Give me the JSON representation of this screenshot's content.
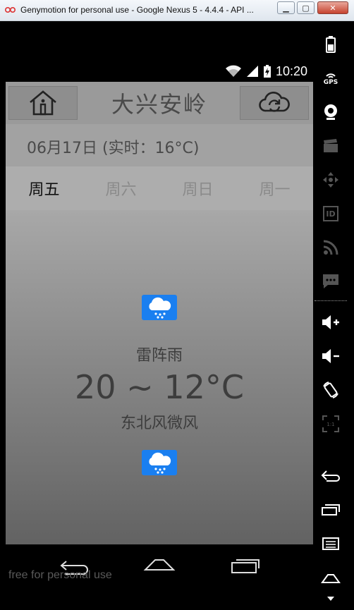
{
  "window": {
    "title": "Genymotion for personal use - Google Nexus 5 - 4.4.4 - API ..."
  },
  "status_bar": {
    "time": "10:20"
  },
  "app": {
    "city": "大兴安岭",
    "date_line": "06月17日 (实时：16°C)",
    "tabs": [
      {
        "label": "周五",
        "active": true
      },
      {
        "label": "周六",
        "active": false
      },
      {
        "label": "周日",
        "active": false
      },
      {
        "label": "周一",
        "active": false
      }
    ],
    "weather": {
      "condition": "雷阵雨",
      "temperature": "20 ~ 12°C",
      "wind": "东北风微风",
      "icon": "rain-cloud-icon",
      "icon_color": "#1a7ff0"
    }
  },
  "watermark": "free for personal use",
  "toolbar": {
    "gps_label": "GPS",
    "id_label": "ID"
  },
  "colors": {
    "title_bar": "#dfe6ee",
    "frame": "#000000",
    "accent_blue": "#1a7ff0"
  }
}
